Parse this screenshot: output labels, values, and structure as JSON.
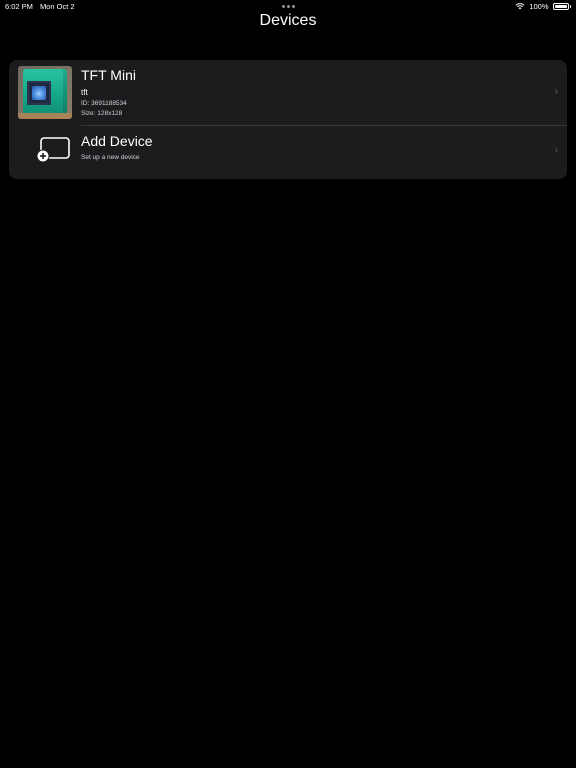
{
  "status_bar": {
    "time": "6:02 PM",
    "date": "Mon Oct 2",
    "battery_text": "100%",
    "battery_level": 1.0,
    "wifi_icon": "wifi-icon"
  },
  "header": {
    "title": "Devices"
  },
  "devices": [
    {
      "name": "TFT Mini",
      "type": "tft",
      "id_text": "ID: 3691188534",
      "size_text": "Size: 128x128"
    }
  ],
  "add_device": {
    "title": "Add Device",
    "subtitle": "Set up a new device",
    "icon": "add-device-icon"
  },
  "chevron_glyph": "›",
  "colors": {
    "background": "#000000",
    "card": "#1c1c1e",
    "separator": "#38383a",
    "chevron": "#636366"
  }
}
